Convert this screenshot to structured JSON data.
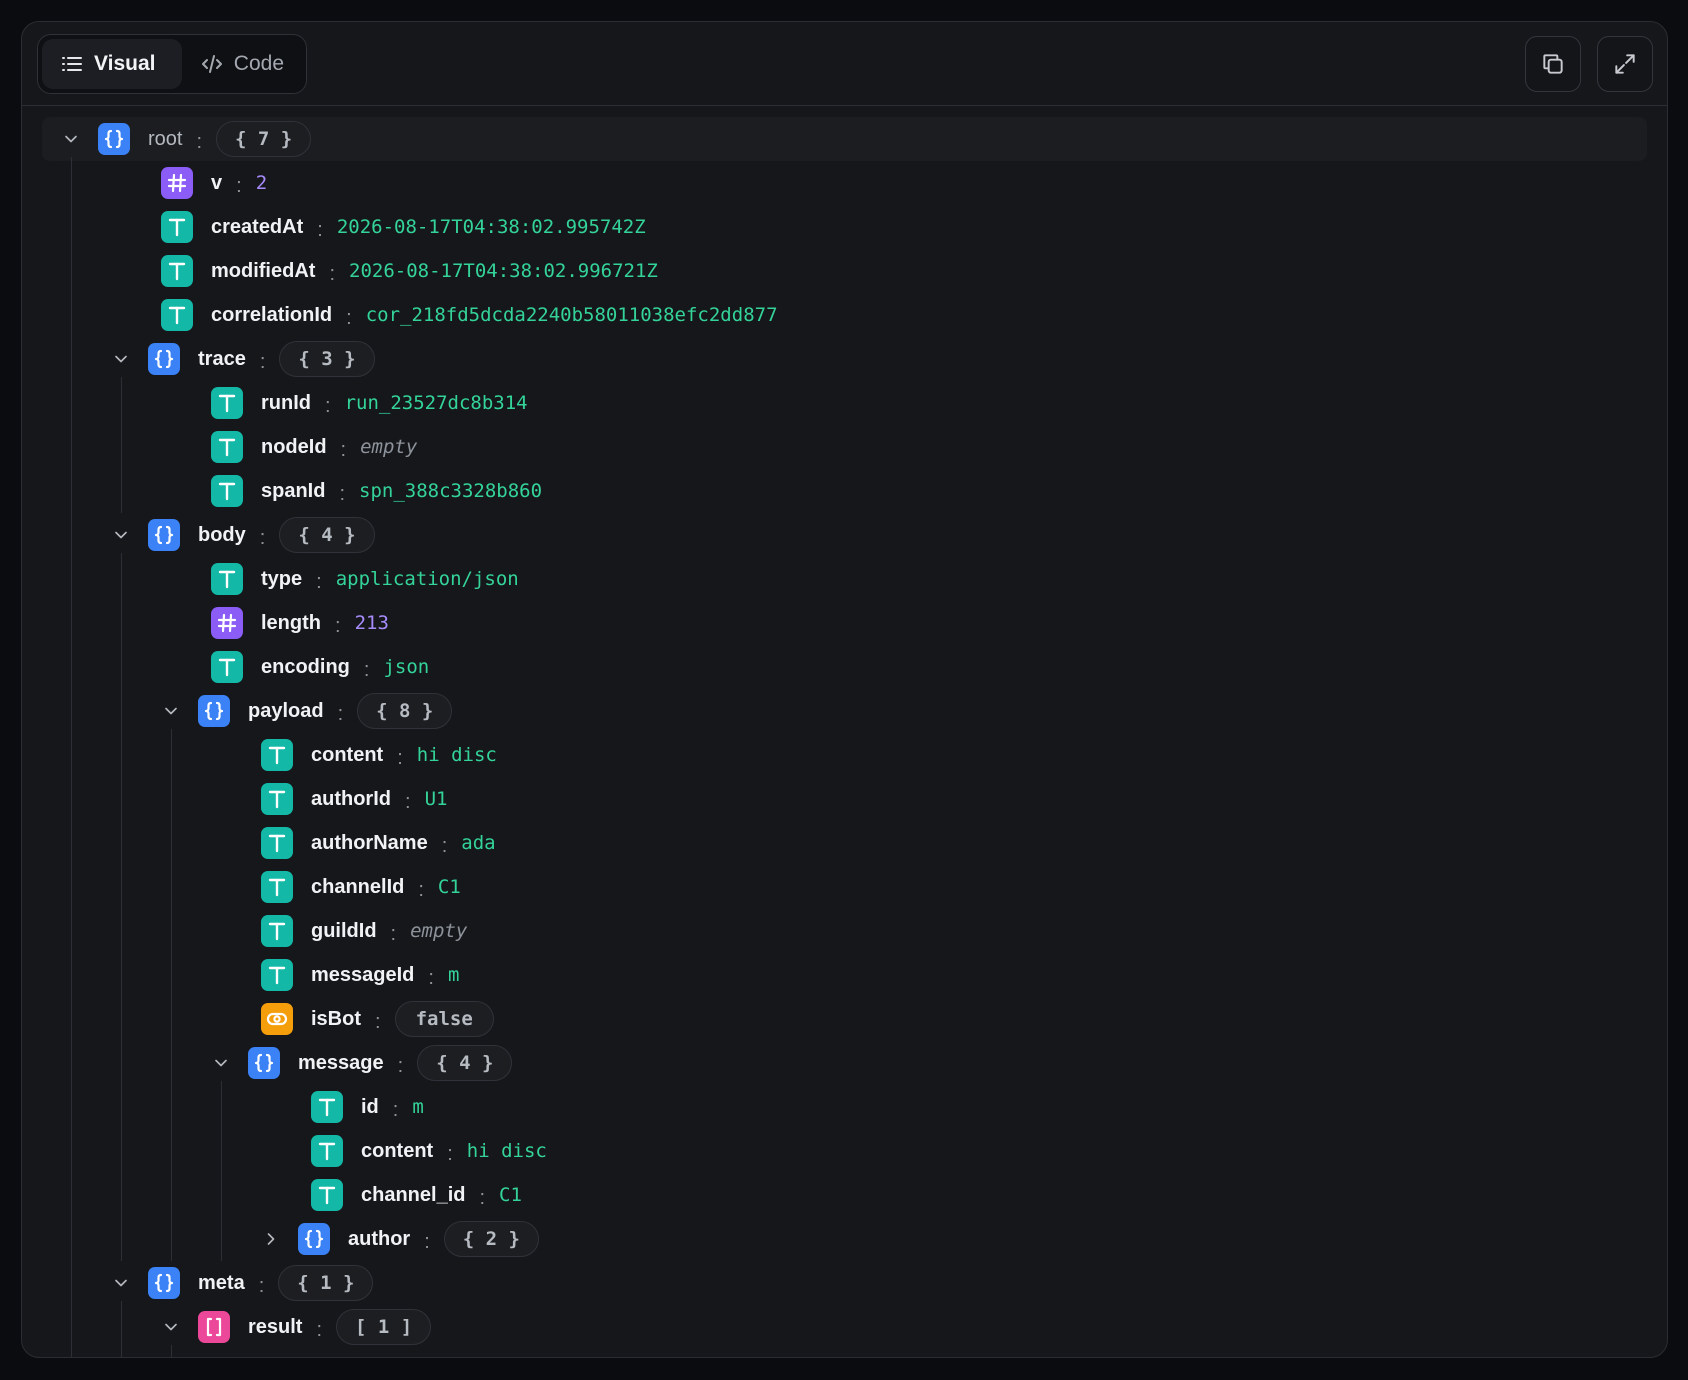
{
  "toolbar": {
    "tabs": [
      {
        "label": "Visual",
        "icon": "list-icon",
        "active": true
      },
      {
        "label": "Code",
        "icon": "code-icon",
        "active": false
      }
    ],
    "actions": [
      {
        "icon": "copy-icon"
      },
      {
        "icon": "expand-icon"
      }
    ]
  },
  "colors": {
    "object": "#3b82f6",
    "number": "#8b5cf6",
    "string": "#14b8a6",
    "boolean": "#f59e0b",
    "array": "#ec4899",
    "string_value": "#34d399",
    "number_value": "#a78bfa"
  },
  "tree": [
    {
      "depth": 0,
      "type": "object",
      "key": "root",
      "count": "{ 7 }",
      "expanded": true
    },
    {
      "depth": 1,
      "type": "number",
      "key": "v",
      "value": "2"
    },
    {
      "depth": 1,
      "type": "string",
      "key": "createdAt",
      "value": "2026-08-17T04:38:02.995742Z"
    },
    {
      "depth": 1,
      "type": "string",
      "key": "modifiedAt",
      "value": "2026-08-17T04:38:02.996721Z"
    },
    {
      "depth": 1,
      "type": "string",
      "key": "correlationId",
      "value": "cor_218fd5dcda2240b58011038efc2dd877"
    },
    {
      "depth": 1,
      "type": "object",
      "key": "trace",
      "count": "{ 3 }",
      "expanded": true
    },
    {
      "depth": 2,
      "type": "string",
      "key": "runId",
      "value": "run_23527dc8b314"
    },
    {
      "depth": 2,
      "type": "string",
      "key": "nodeId",
      "value": "empty",
      "empty": true
    },
    {
      "depth": 2,
      "type": "string",
      "key": "spanId",
      "value": "spn_388c3328b860"
    },
    {
      "depth": 1,
      "type": "object",
      "key": "body",
      "count": "{ 4 }",
      "expanded": true
    },
    {
      "depth": 2,
      "type": "string",
      "key": "type",
      "value": "application/json"
    },
    {
      "depth": 2,
      "type": "number",
      "key": "length",
      "value": "213"
    },
    {
      "depth": 2,
      "type": "string",
      "key": "encoding",
      "value": "json"
    },
    {
      "depth": 2,
      "type": "object",
      "key": "payload",
      "count": "{ 8 }",
      "expanded": true
    },
    {
      "depth": 3,
      "type": "string",
      "key": "content",
      "value": "hi disc"
    },
    {
      "depth": 3,
      "type": "string",
      "key": "authorId",
      "value": "U1"
    },
    {
      "depth": 3,
      "type": "string",
      "key": "authorName",
      "value": "ada"
    },
    {
      "depth": 3,
      "type": "string",
      "key": "channelId",
      "value": "C1"
    },
    {
      "depth": 3,
      "type": "string",
      "key": "guildId",
      "value": "empty",
      "empty": true
    },
    {
      "depth": 3,
      "type": "string",
      "key": "messageId",
      "value": "m"
    },
    {
      "depth": 3,
      "type": "boolean",
      "key": "isBot",
      "value": "false"
    },
    {
      "depth": 3,
      "type": "object",
      "key": "message",
      "count": "{ 4 }",
      "expanded": true
    },
    {
      "depth": 4,
      "type": "string",
      "key": "id",
      "value": "m"
    },
    {
      "depth": 4,
      "type": "string",
      "key": "content",
      "value": "hi disc"
    },
    {
      "depth": 4,
      "type": "string",
      "key": "channel_id",
      "value": "C1"
    },
    {
      "depth": 4,
      "type": "object",
      "key": "author",
      "count": "{ 2 }",
      "expanded": false
    },
    {
      "depth": 1,
      "type": "object",
      "key": "meta",
      "count": "{ 1 }",
      "expanded": true
    },
    {
      "depth": 2,
      "type": "array",
      "key": "result",
      "count": "[ 1 ]",
      "expanded": true
    }
  ]
}
